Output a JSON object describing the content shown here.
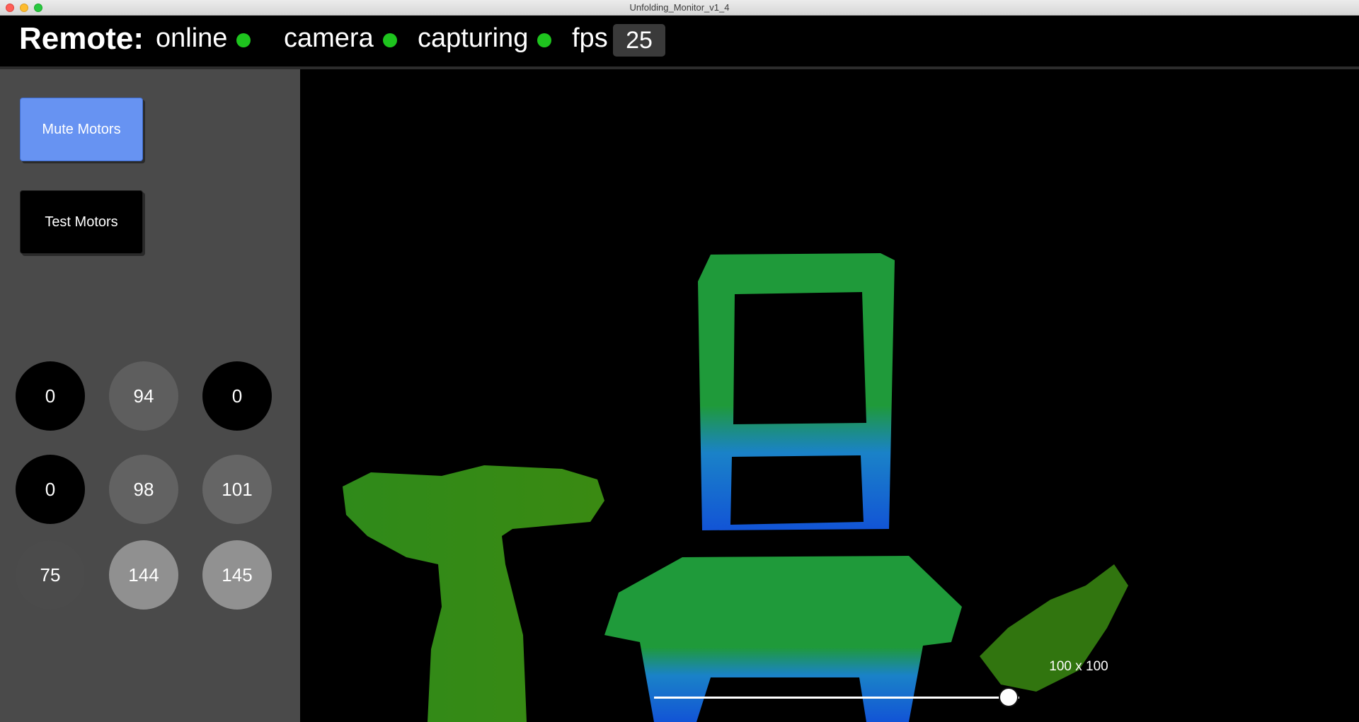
{
  "window": {
    "title": "Unfolding_Monitor_v1_4"
  },
  "status": {
    "title": "Remote:",
    "items": [
      {
        "label": "online",
        "state_color": "#1ec41e"
      },
      {
        "label": "camera",
        "state_color": "#1ec41e"
      },
      {
        "label": "capturing",
        "state_color": "#1ec41e"
      }
    ],
    "fps_label": "fps",
    "fps_value": "25"
  },
  "controls": {
    "mute_label": "Mute Motors",
    "test_label": "Test Motors",
    "mute_color": "#6793f2"
  },
  "motors": [
    {
      "value": "0",
      "color": "#000000"
    },
    {
      "value": "94",
      "color": "#5e5e5e"
    },
    {
      "value": "0",
      "color": "#000000"
    },
    {
      "value": "0",
      "color": "#000000"
    },
    {
      "value": "98",
      "color": "#626262"
    },
    {
      "value": "101",
      "color": "#656565"
    },
    {
      "value": "75",
      "color": "#4b4b4b"
    },
    {
      "value": "144",
      "color": "#909090"
    },
    {
      "value": "145",
      "color": "#919191"
    }
  ],
  "camera_view": {
    "resolution_label": "100 x 100",
    "resolution_slider_value": 0.97,
    "depth_palette": [
      "#2f8a1a",
      "#1f9a3a",
      "#1a82c8",
      "#1254d6"
    ]
  }
}
